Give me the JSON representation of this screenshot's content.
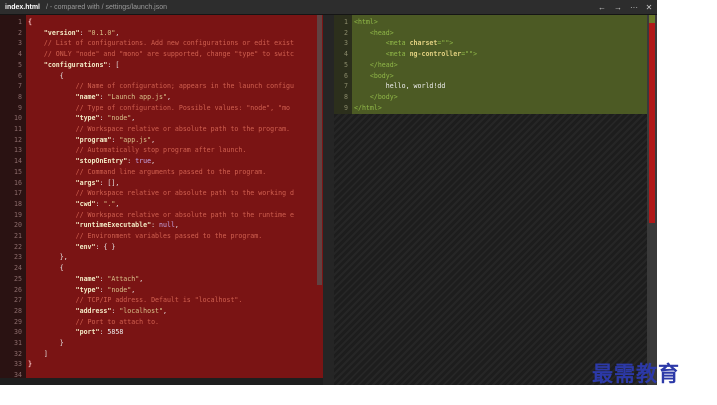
{
  "titlebar": {
    "filename": "index.html",
    "compare_text": "/ - compared with / settings/launch.json",
    "icons": [
      "arrow-left-icon",
      "arrow-right-icon",
      "more-icon",
      "close-icon"
    ],
    "icon_glyphs": [
      "←",
      "→",
      "···",
      "✕"
    ]
  },
  "left": {
    "line_numbers": [
      "1",
      "2",
      "3",
      "4",
      "5",
      "6",
      "7",
      "8",
      "9",
      "10",
      "11",
      "12",
      "13",
      "14",
      "15",
      "16",
      "17",
      "18",
      "19",
      "20",
      "21",
      "22",
      "23",
      "24",
      "25",
      "26",
      "27",
      "28",
      "29",
      "30",
      "31",
      "32",
      "33",
      "34"
    ],
    "lines": [
      [
        {
          "t": "{",
          "c": "hl"
        }
      ],
      [
        {
          "t": "    \"version\"",
          "c": "k"
        },
        {
          "t": ": ",
          "c": "p"
        },
        {
          "t": "\"0.1.0\"",
          "c": "s"
        },
        {
          "t": ",",
          "c": "p"
        }
      ],
      [
        {
          "t": "    // List of configurations. Add new configurations or edit exist",
          "c": "c"
        }
      ],
      [
        {
          "t": "    // ONLY \"node\" and \"mono\" are supported, change \"type\" to switc",
          "c": "c"
        }
      ],
      [
        {
          "t": "    \"configurations\"",
          "c": "k"
        },
        {
          "t": ": [",
          "c": "p"
        }
      ],
      [
        {
          "t": "        {",
          "c": "p"
        }
      ],
      [
        {
          "t": "            // Name of configuration; appears in the launch configu",
          "c": "c"
        }
      ],
      [
        {
          "t": "            \"name\"",
          "c": "k"
        },
        {
          "t": ": ",
          "c": "p"
        },
        {
          "t": "\"Launch app.js\"",
          "c": "s"
        },
        {
          "t": ",",
          "c": "p"
        }
      ],
      [
        {
          "t": "            // Type of configuration. Possible values: \"node\", \"mo",
          "c": "c"
        }
      ],
      [
        {
          "t": "            \"type\"",
          "c": "k"
        },
        {
          "t": ": ",
          "c": "p"
        },
        {
          "t": "\"node\"",
          "c": "s"
        },
        {
          "t": ",",
          "c": "p"
        }
      ],
      [
        {
          "t": "            // Workspace relative or absolute path to the program.",
          "c": "c"
        }
      ],
      [
        {
          "t": "            \"program\"",
          "c": "k"
        },
        {
          "t": ": ",
          "c": "p"
        },
        {
          "t": "\"app.js\"",
          "c": "s"
        },
        {
          "t": ",",
          "c": "p"
        }
      ],
      [
        {
          "t": "            // Automatically stop program after launch.",
          "c": "c"
        }
      ],
      [
        {
          "t": "            \"stopOnEntry\"",
          "c": "k"
        },
        {
          "t": ": ",
          "c": "p"
        },
        {
          "t": "true",
          "c": "n"
        },
        {
          "t": ",",
          "c": "p"
        }
      ],
      [
        {
          "t": "            // Command line arguments passed to the program.",
          "c": "c"
        }
      ],
      [
        {
          "t": "            \"args\"",
          "c": "k"
        },
        {
          "t": ": [],",
          "c": "p"
        }
      ],
      [
        {
          "t": "            // Workspace relative or absolute path to the working d",
          "c": "c"
        }
      ],
      [
        {
          "t": "            \"cwd\"",
          "c": "k"
        },
        {
          "t": ": ",
          "c": "p"
        },
        {
          "t": "\".\"",
          "c": "s"
        },
        {
          "t": ",",
          "c": "p"
        }
      ],
      [
        {
          "t": "            // Workspace relative or absolute path to the runtime e",
          "c": "c"
        }
      ],
      [
        {
          "t": "            \"runtimeExecutable\"",
          "c": "k"
        },
        {
          "t": ": ",
          "c": "p"
        },
        {
          "t": "null",
          "c": "n"
        },
        {
          "t": ",",
          "c": "p"
        }
      ],
      [
        {
          "t": "            // Environment variables passed to the program.",
          "c": "c"
        }
      ],
      [
        {
          "t": "            \"env\"",
          "c": "k"
        },
        {
          "t": ": { }",
          "c": "p"
        }
      ],
      [
        {
          "t": "        },",
          "c": "p"
        }
      ],
      [
        {
          "t": "        {",
          "c": "p"
        }
      ],
      [
        {
          "t": "            \"name\"",
          "c": "k"
        },
        {
          "t": ": ",
          "c": "p"
        },
        {
          "t": "\"Attach\"",
          "c": "s"
        },
        {
          "t": ",",
          "c": "p"
        }
      ],
      [
        {
          "t": "            \"type\"",
          "c": "k"
        },
        {
          "t": ": ",
          "c": "p"
        },
        {
          "t": "\"node\"",
          "c": "s"
        },
        {
          "t": ",",
          "c": "p"
        }
      ],
      [
        {
          "t": "            // TCP/IP address. Default is \"localhost\".",
          "c": "c"
        }
      ],
      [
        {
          "t": "            \"address\"",
          "c": "k"
        },
        {
          "t": ": ",
          "c": "p"
        },
        {
          "t": "\"localhost\"",
          "c": "s"
        },
        {
          "t": ",",
          "c": "p"
        }
      ],
      [
        {
          "t": "            // Port to attach to.",
          "c": "c"
        }
      ],
      [
        {
          "t": "            \"port\"",
          "c": "k"
        },
        {
          "t": ": ",
          "c": "p"
        },
        {
          "t": "5858",
          "c": "plain"
        }
      ],
      [
        {
          "t": "        }",
          "c": "p"
        }
      ],
      [
        {
          "t": "    ]",
          "c": "p"
        }
      ],
      [
        {
          "t": "}",
          "c": "hl"
        }
      ],
      []
    ]
  },
  "right": {
    "line_numbers": [
      "1",
      "2",
      "3",
      "4",
      "5",
      "6",
      "7",
      "8",
      "9"
    ],
    "lines": [
      [
        {
          "t": "<html>",
          "c": "t"
        }
      ],
      [
        {
          "t": "    <head>",
          "c": "t"
        }
      ],
      [
        {
          "t": "        <meta ",
          "c": "t"
        },
        {
          "t": "charset",
          "c": "a"
        },
        {
          "t": "=\"\">",
          "c": "t"
        }
      ],
      [
        {
          "t": "        <meta ",
          "c": "t"
        },
        {
          "t": "ng-controller",
          "c": "a"
        },
        {
          "t": "=\"\">",
          "c": "t"
        }
      ],
      [
        {
          "t": "    </head>",
          "c": "t"
        }
      ],
      [
        {
          "t": "    <body>",
          "c": "t"
        }
      ],
      [
        {
          "t": "        hello, world!dd",
          "c": "plain"
        }
      ],
      [
        {
          "t": "    </body>",
          "c": "t"
        }
      ],
      [
        {
          "t": "</html>",
          "c": "t"
        }
      ]
    ]
  },
  "watermark": "最需教育"
}
